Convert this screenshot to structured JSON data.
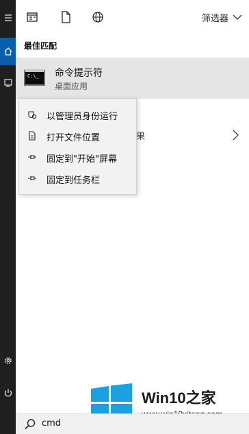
{
  "toolbar": {
    "icons": [
      "apps-icon",
      "document-icon",
      "web-icon"
    ],
    "filter_label": "筛选器"
  },
  "best_match": {
    "section_title": "最佳匹配",
    "app_name": "命令提示符",
    "app_type": "桌面应用"
  },
  "second_result": {
    "text_fragment": "果"
  },
  "context_menu": {
    "items": [
      {
        "label": "以管理员身份运行",
        "icon": "shield-icon"
      },
      {
        "label": "打开文件位置",
        "icon": "file-icon"
      },
      {
        "label": "固定到\"开始\"屏幕",
        "icon": "pin-icon"
      },
      {
        "label": "固定到任务栏",
        "icon": "pin-icon"
      }
    ]
  },
  "search": {
    "value": "cmd"
  },
  "watermark": {
    "brand_prefix": "Win10",
    "brand_suffix": "之家",
    "site": "www.win10xitong.com"
  },
  "colors": {
    "rail": "#1f1f1f",
    "rail_active": "#0a5eb0",
    "selection": "#e5e5e5",
    "context_menu_bg": "#f2f2f2",
    "windows_logo": "#1ba1e2"
  }
}
